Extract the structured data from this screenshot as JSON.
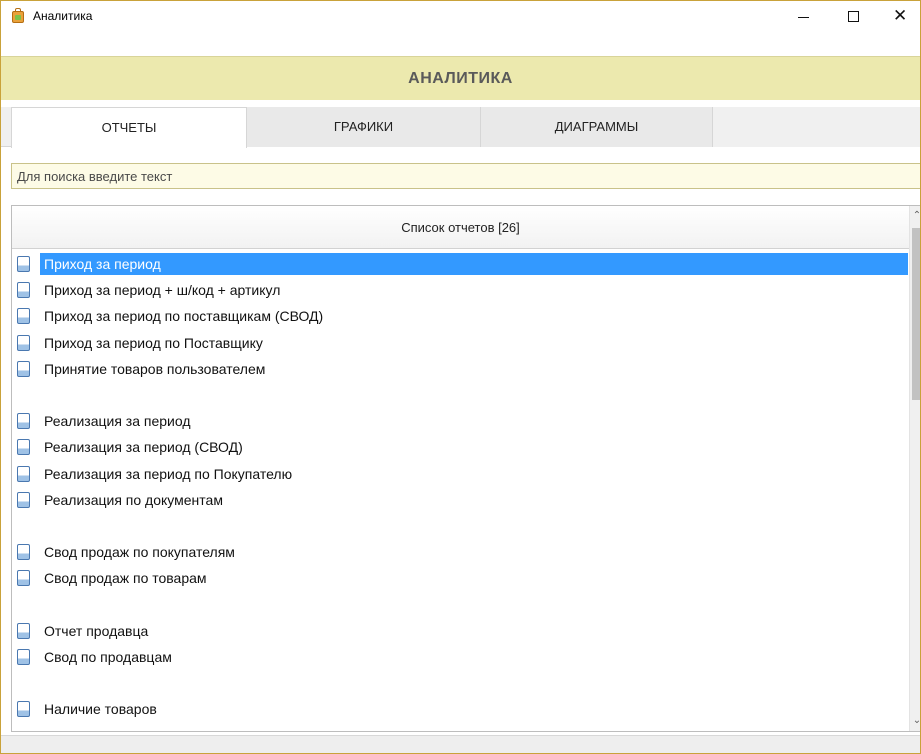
{
  "window": {
    "title": "Аналитика",
    "controls": {
      "minimize_icon": "minimize-icon",
      "maximize_icon": "maximize-icon",
      "close_icon": "close-icon",
      "close_glyph": "✕"
    }
  },
  "header": {
    "title": "АНАЛИТИКА"
  },
  "tabs": [
    {
      "label": "ОТЧЕТЫ",
      "active": true
    },
    {
      "label": "ГРАФИКИ",
      "active": false
    },
    {
      "label": "ДИАГРАММЫ",
      "active": false
    }
  ],
  "search": {
    "placeholder": "Для поиска введите текст",
    "value": ""
  },
  "list": {
    "header": "Список отчетов [26]",
    "selected_index": 0,
    "items": [
      {
        "label": "Приход за период"
      },
      {
        "label": "Приход за период + ш/код + артикул"
      },
      {
        "label": "Приход за период по поставщикам (СВОД)"
      },
      {
        "label": "Приход за период по Поставщику"
      },
      {
        "label": "Принятие товаров пользователем"
      },
      {
        "label": ""
      },
      {
        "label": "Реализация за период"
      },
      {
        "label": "Реализация за период (СВОД)"
      },
      {
        "label": "Реализация за период по Покупателю"
      },
      {
        "label": "Реализация по документам"
      },
      {
        "label": ""
      },
      {
        "label": "Свод продаж по покупателям"
      },
      {
        "label": "Свод продаж по товарам"
      },
      {
        "label": ""
      },
      {
        "label": "Отчет продавца"
      },
      {
        "label": "Свод по продавцам"
      },
      {
        "label": ""
      },
      {
        "label": "Наличие товаров"
      }
    ]
  },
  "colors": {
    "accent_header": "#ece9ae",
    "selection": "#3399ff",
    "search_bg": "#fdfbe6"
  }
}
